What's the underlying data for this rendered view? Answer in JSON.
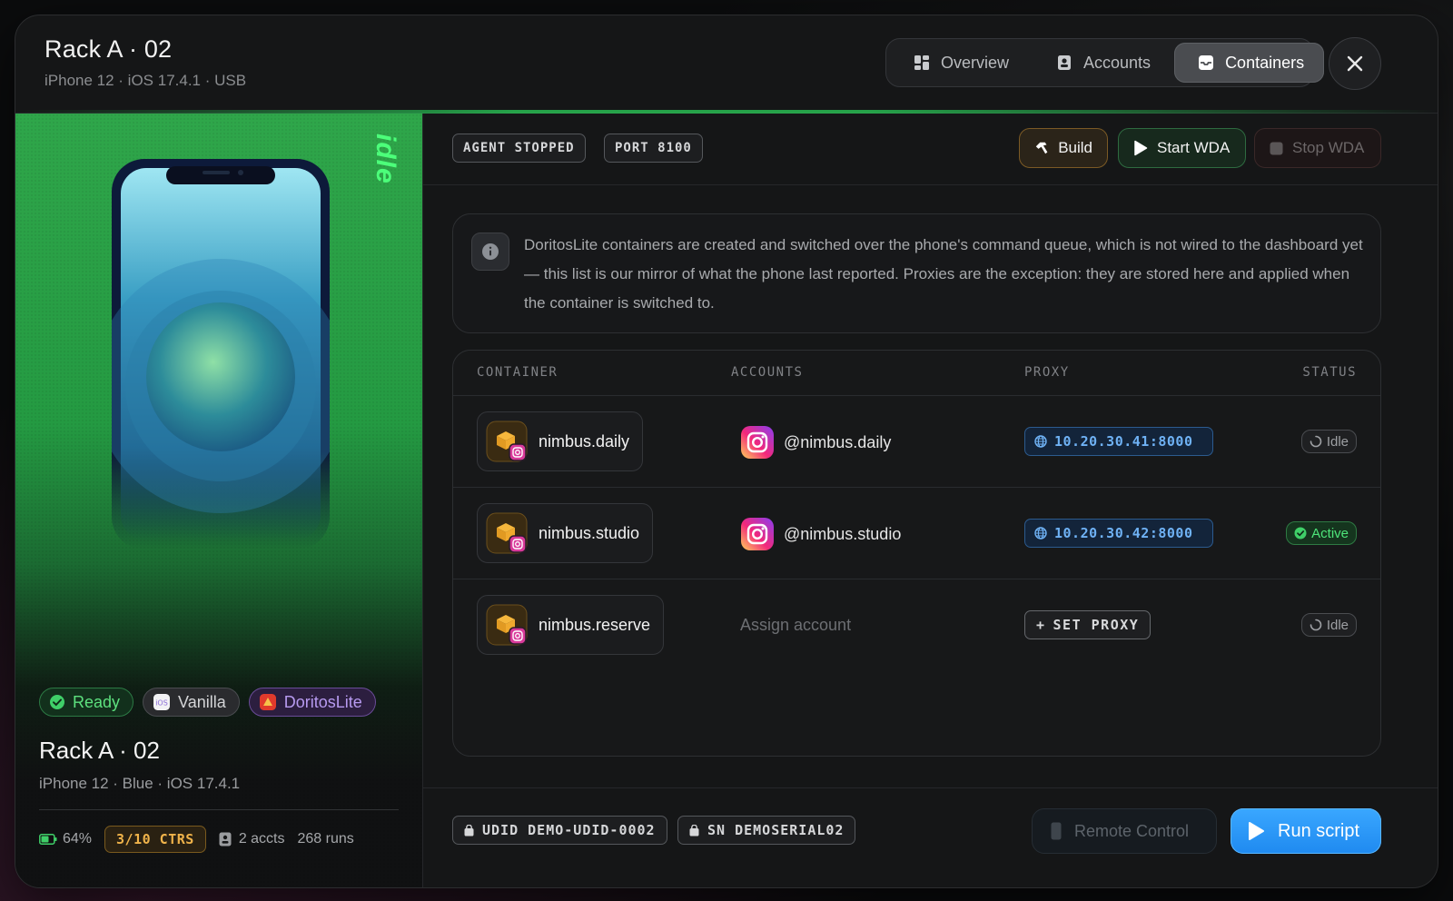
{
  "header": {
    "title": "Rack A · 02",
    "subtitle": "iPhone 12 · iOS 17.4.1 · USB"
  },
  "tabs": [
    {
      "label": "Overview",
      "icon": "grid-icon",
      "active": false
    },
    {
      "label": "Accounts",
      "icon": "id-badge-icon",
      "active": false
    },
    {
      "label": "Containers",
      "icon": "tray-icon",
      "active": true
    }
  ],
  "device": {
    "state_label": "idle",
    "badges": {
      "ready": "Ready",
      "vanilla": "Vanilla",
      "doritos": "DoritosLite"
    },
    "title": "Rack A · 02",
    "subtitle": "iPhone 12 · Blue · iOS 17.4.1",
    "battery": "64%",
    "battery_level": 0.64,
    "containers": "3/10 CTRS",
    "accounts": "2 accts",
    "runs": "268 runs"
  },
  "toolbar": {
    "agent_status": "AGENT STOPPED",
    "port": "PORT 8100",
    "build_label": "Build",
    "start_label": "Start WDA",
    "stop_label": "Stop WDA"
  },
  "info": {
    "text": "DoritosLite containers are created and switched over the phone's command queue, which is not wired to the dashboard yet — this list is our mirror of what the phone last reported. Proxies are the exception: they are stored here and applied when the container is switched to."
  },
  "table": {
    "headers": {
      "container": "CONTAINER",
      "accounts": "ACCOUNTS",
      "proxy": "PROXY",
      "status": "STATUS"
    },
    "rows": [
      {
        "container": "nimbus.daily",
        "account": "@nimbus.daily",
        "proxy": "10.20.30.41:8000",
        "status": "Idle"
      },
      {
        "container": "nimbus.studio",
        "account": "@nimbus.studio",
        "proxy": "10.20.30.42:8000",
        "status": "Active"
      },
      {
        "container": "nimbus.reserve",
        "account": "Assign account",
        "proxy": "SET PROXY",
        "status": "Idle"
      }
    ]
  },
  "footer": {
    "udid": "UDID DEMO-UDID-0002",
    "serial": "SN DEMOSERIAL02",
    "remote_label": "Remote Control",
    "run_label": "Run script"
  },
  "colors": {
    "accent_green": "#2bd05a",
    "accent_blue": "#1f8af0",
    "accent_amber": "#f0b34a"
  }
}
